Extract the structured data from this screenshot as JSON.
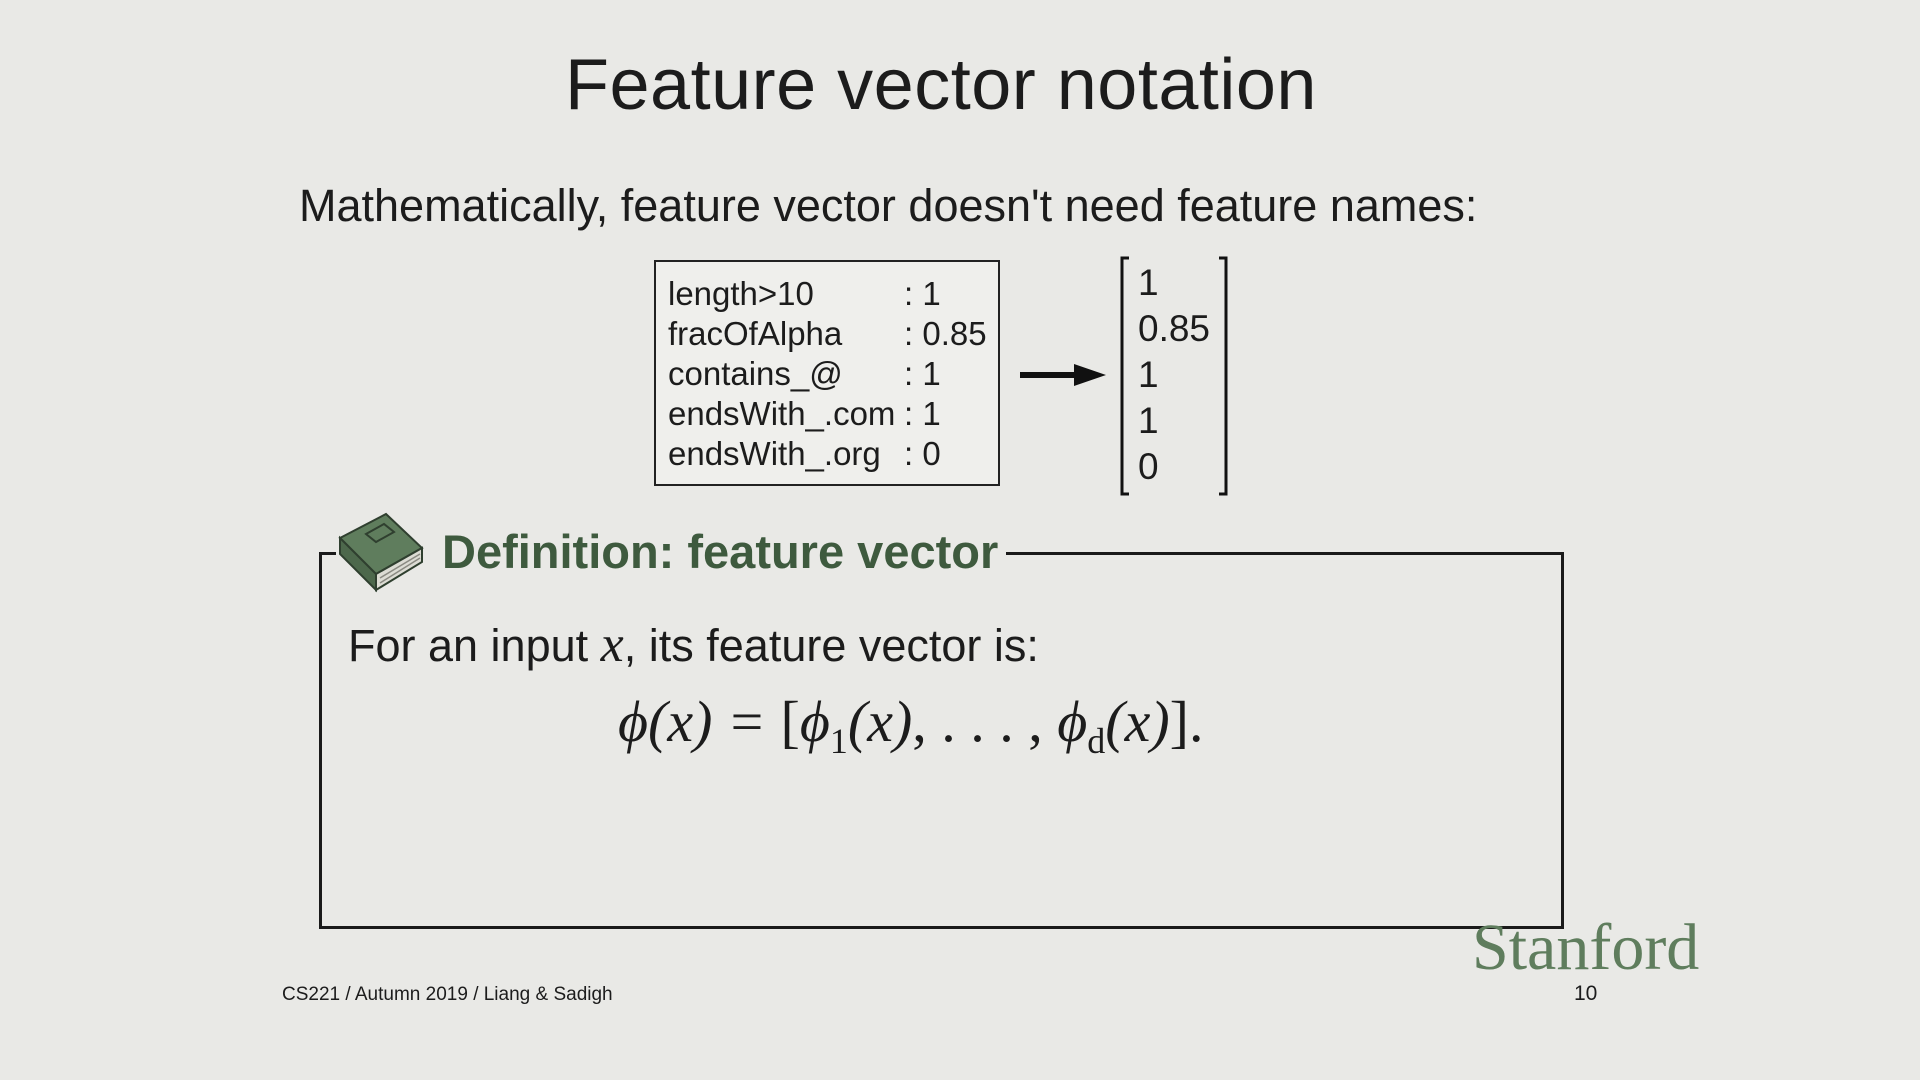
{
  "slide": {
    "title": "Feature vector notation",
    "intro": "Mathematically, feature vector doesn't need feature names:"
  },
  "feature_table": [
    {
      "name": "length>10",
      "value": ": 1"
    },
    {
      "name": "fracOfAlpha",
      "value": ": 0.85"
    },
    {
      "name": "contains_@",
      "value": ": 1"
    },
    {
      "name": "endsWith_.com",
      "value": ": 1"
    },
    {
      "name": "endsWith_.org",
      "value": ": 0"
    }
  ],
  "vector": [
    "1",
    "0.85",
    "1",
    "1",
    "0"
  ],
  "definition": {
    "title": "Definition: feature vector",
    "text_before": "For an input ",
    "variable": "x",
    "text_after": ", its feature vector is:",
    "formula": {
      "lhs": "ϕ(x) = ",
      "open": "[",
      "phi": "ϕ",
      "sub1": "1",
      "arg": "(x)",
      "middle": ", . . . , ",
      "subd": "d",
      "close": "]."
    }
  },
  "footer": {
    "course": "CS221 / Autumn 2019 / Liang & Sadigh",
    "logo": "Stanford",
    "page": "10"
  },
  "colors": {
    "background": "#e9e9e6",
    "definition_title": "#3e5a3e",
    "logo": "#5f7d5d",
    "icon": "book-icon"
  }
}
